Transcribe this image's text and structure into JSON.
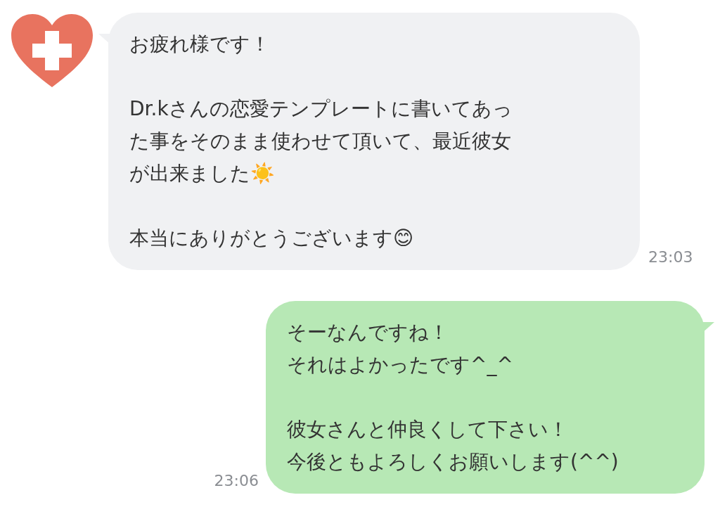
{
  "messages": [
    {
      "kind": "incoming",
      "paragraphs": [
        [
          "お疲れ様です！"
        ],
        [
          "Dr.kさんの恋愛テンプレートに書いてあっ",
          "た事をそのまま使わせて頂いて、最近彼女",
          "が出来ました☀️"
        ],
        [
          "本当にありがとうございます😊"
        ]
      ],
      "time": "23:03"
    },
    {
      "kind": "outgoing",
      "paragraphs": [
        [
          "そーなんですね！",
          "それはよかったです^_^"
        ],
        [
          "彼女さんと仲良くして下さい！",
          "今後ともよろしくお願いします(^^)"
        ]
      ],
      "time": "23:06"
    }
  ]
}
